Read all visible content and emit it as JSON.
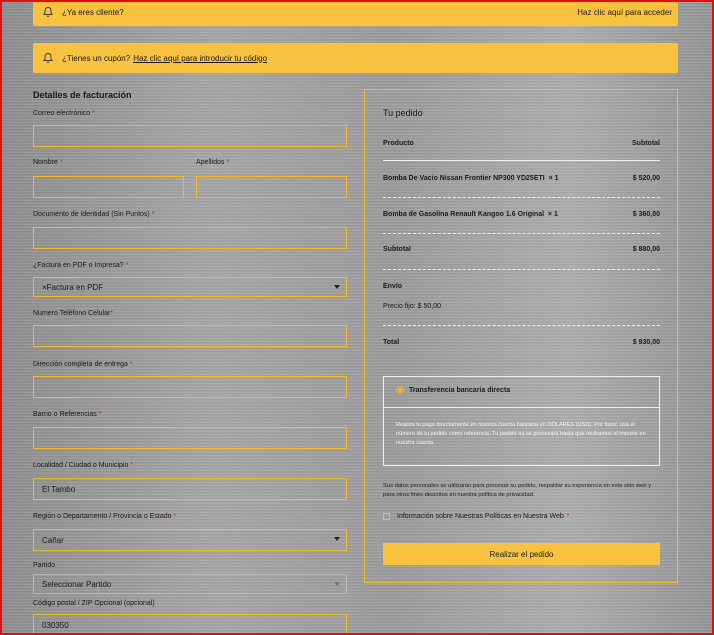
{
  "banners": {
    "returning_text": "¿Ya eres cliente?",
    "returning_link": "Haz clic aquí para acceder",
    "coupon_text": "¿Tienes un cupón?",
    "coupon_link": "Haz clic aquí para introducir tu código"
  },
  "billing": {
    "title": "Detalles de facturación",
    "email_label": "Correo electrónico",
    "first_name_label": "Nombre",
    "last_name_label": "Apellidos",
    "id_label": "Documento de Identidad (Sin Puntos)",
    "invoice_label": "¿Factura en PDF o Impresa?",
    "invoice_value": "×Factura en PDF",
    "phone_label": "Numero Teléfono Celular",
    "address_label": "Dirección completa de entrega",
    "neighborhood_label": "Barrio o Referencias",
    "city_label": "Localidad / Ciudad o Municipio",
    "city_value": "El Tambo",
    "region_label": "Región o Departamento / Provincia o Estado",
    "region_value": "Cañar",
    "district_label": "Partido",
    "district_value": "Seleccionar Partido",
    "postcode_label": "Código postal / ZIP Opcional (opcional)",
    "postcode_value": "030350",
    "required_mark": "*"
  },
  "order": {
    "title": "Tu pedido",
    "col_product": "Producto",
    "col_subtotal": "Subtotal",
    "items": [
      {
        "name": "Bomba De Vacio Nissan Frontier NP300 YD25ETI",
        "qty": "× 1",
        "price": "$ 520,00"
      },
      {
        "name": "Bomba de Gasolina Renault Kangoo 1.6 Original",
        "qty": "× 1",
        "price": "$ 360,00"
      }
    ],
    "subtotal_label": "Subtotal",
    "subtotal_value": "$ 880,00",
    "shipping_label": "Envío",
    "shipping_value": "Precio fijo: $ 50,00",
    "total_label": "Total",
    "total_value": "$ 930,00"
  },
  "payment": {
    "method": "Transferencia bancaria directa",
    "description": "Realiza tu pago directamente en nuestra cuenta bancaria en DÓLARES (USD). Por favor, usa el número de tu pedido como referencia. Tu pedido no se procesará hasta que recibamos el importe en nuestra cuenta.",
    "privacy": "Sus datos personales se utilizarán para procesar su pedido, respaldar su experiencia en este sitio web y para otros fines descritos en nuestra política de privacidad.",
    "terms_label": "Información sobre Nuestras Políticas en Nuestra Web",
    "place_order": "Realizar el pedido"
  }
}
